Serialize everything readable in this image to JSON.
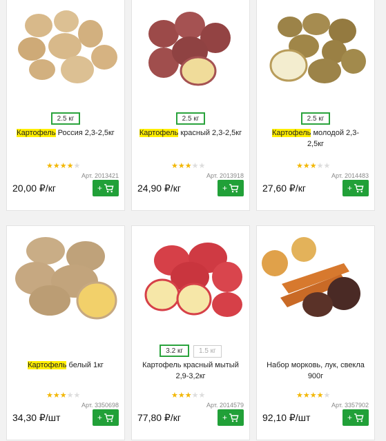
{
  "products": [
    {
      "sizes": [
        {
          "label": "2.5 кг",
          "active": true
        }
      ],
      "title_highlight": "Картофель",
      "title_rest": " Россия 2,3-2,5кг",
      "rating": 4,
      "sku": "Арт. 2013421",
      "price": "20,00 ₽/кг",
      "image": "potatoes-russia"
    },
    {
      "sizes": [
        {
          "label": "2.5 кг",
          "active": true
        }
      ],
      "title_highlight": "Картофель",
      "title_rest": " красный 2,3-2,5кг",
      "rating": 3,
      "sku": "Арт. 2013918",
      "price": "24,90 ₽/кг",
      "image": "potatoes-red"
    },
    {
      "sizes": [
        {
          "label": "2.5 кг",
          "active": true
        }
      ],
      "title_highlight": "Картофель",
      "title_rest": " молодой 2,3-2,5кг",
      "rating": 3,
      "sku": "Арт. 2014483",
      "price": "27,60 ₽/кг",
      "image": "potatoes-young"
    },
    {
      "sizes": [],
      "title_highlight": "Картофель",
      "title_rest": " белый 1кг",
      "rating": 3,
      "sku": "Арт. 3350698",
      "price": "34,30 ₽/шт",
      "image": "potatoes-white"
    },
    {
      "sizes": [
        {
          "label": "3.2 кг",
          "active": true
        },
        {
          "label": "1.5 кг",
          "active": false
        }
      ],
      "title_highlight": "",
      "title_rest": "Картофель красный мытый 2,9-3,2кг",
      "rating": 3,
      "sku": "Арт. 2014579",
      "price": "77,80 ₽/кг",
      "image": "potatoes-red-washed"
    },
    {
      "sizes": [],
      "title_highlight": "",
      "title_rest": "Набор морковь, лук, свекла 900г",
      "rating": 4,
      "sku": "Арт. 3357902",
      "price": "92,10 ₽/шт",
      "image": "veg-set"
    }
  ],
  "cart_button_label": "+",
  "cart_icon": "cart-icon",
  "colors": {
    "accent": "#21a038",
    "highlight": "#ffee00",
    "star_on": "#f2b705",
    "star_off": "#dddddd"
  }
}
